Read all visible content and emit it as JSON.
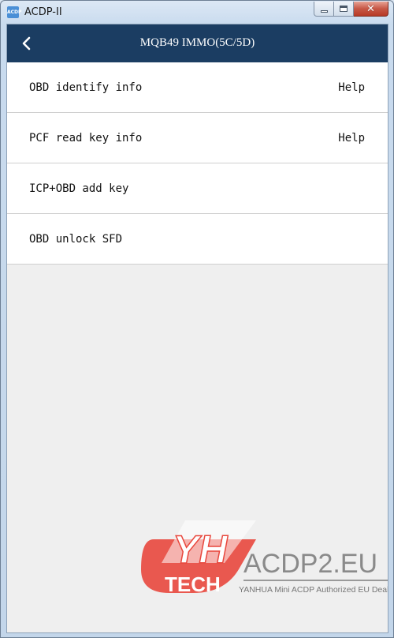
{
  "window": {
    "title": "ACDP-II",
    "icon_text": "ACDP",
    "controls": {
      "minimize": "minimize",
      "maximize": "maximize",
      "close": "close"
    }
  },
  "navbar": {
    "title": "MQB49 IMMO(5C/5D)",
    "background": "#1b3d62"
  },
  "menu": {
    "items": [
      {
        "label": "OBD identify info",
        "help": "Help"
      },
      {
        "label": "PCF read key info",
        "help": "Help"
      },
      {
        "label": "ICP+OBD add key"
      },
      {
        "label": "OBD unlock SFD"
      }
    ]
  },
  "watermark": {
    "logo_text": "YH",
    "tech_text": "TECH",
    "site": "ACDP2.EU",
    "tagline": "YANHUA Mini ACDP Authorized EU Dealer",
    "accent": "#e8473d"
  }
}
